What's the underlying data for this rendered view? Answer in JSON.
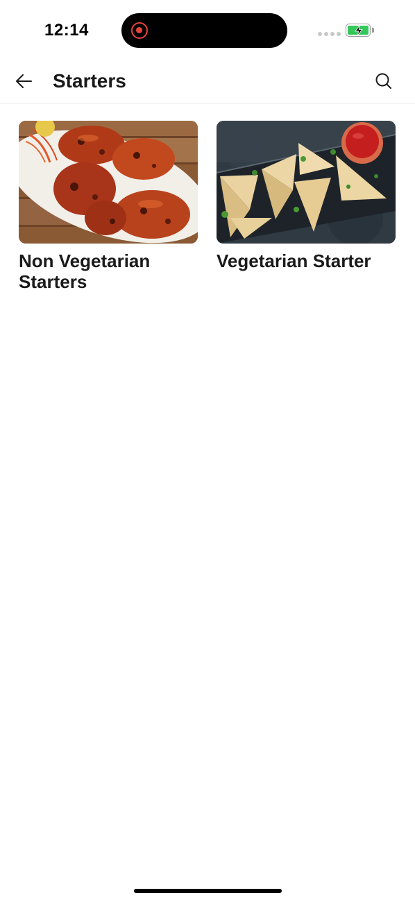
{
  "status_bar": {
    "time": "12:14",
    "battery_color": "#34c759",
    "recording_color": "#e8443b"
  },
  "header": {
    "title": "Starters",
    "back_icon": "arrow-left-icon",
    "search_icon": "search-icon"
  },
  "categories": [
    {
      "label": "Non Vegetarian Starters",
      "image": "tandoori-chicken-photo"
    },
    {
      "label": "Vegetarian Starter",
      "image": "samosa-with-ketchup-photo"
    }
  ]
}
